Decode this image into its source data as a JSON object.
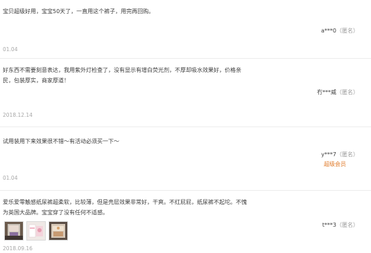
{
  "reviews": [
    {
      "text": "宝贝超级好用，宝宝50天了，一直用这个裤子，用完再回购。",
      "user": "a***0",
      "anon": "（匿名）",
      "date": "01.04"
    },
    {
      "text": "好东西不需要刻意表达，我用紫外灯检查了，没有显示有增白荧光剂，不厚却吸水效果好，价格亲民，包装厚实，商家厚道！",
      "user": "冇***威",
      "anon": "（匿名）",
      "date": "2018.12.14"
    },
    {
      "text": "试用装用下来效果很不错～有活动必须买一下～",
      "user": "y***7",
      "anon": "（匿名）",
      "tag": "超级会员",
      "date": "01.04"
    },
    {
      "text": "爱乐爱零触感纸尿裤超柔软，比较薄，但是壳层效果非常好，干爽。不红屁屁，纸尿裤不起坨。不愧为英国大品牌。宝宝穿了没有任何不适感。",
      "user": "t***3",
      "anon": "（匿名）",
      "date": "2018.09.16",
      "photos": [
        "photo-1",
        "photo-2",
        "photo-3"
      ]
    }
  ]
}
